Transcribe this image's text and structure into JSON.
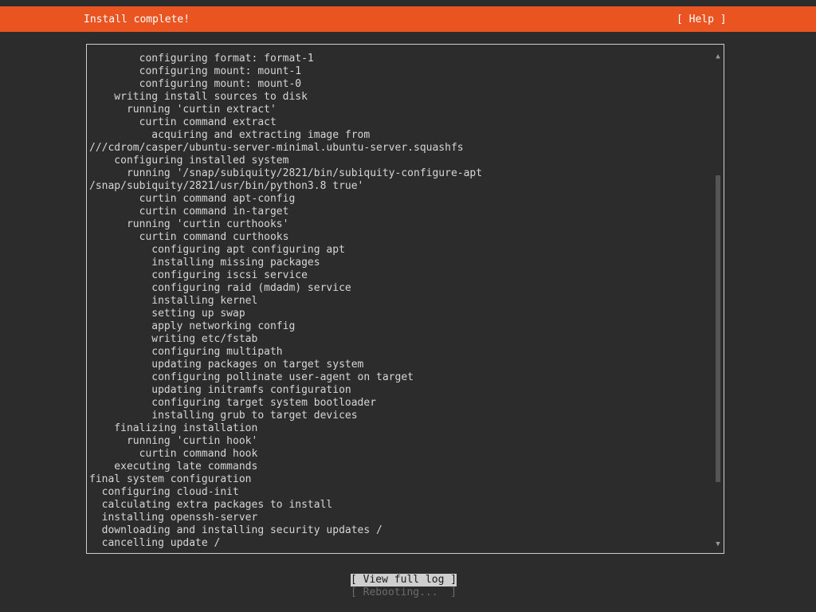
{
  "header": {
    "title": "Install complete!",
    "help_label": "[ Help ]"
  },
  "log": {
    "lines": [
      "        configuring format: format-1",
      "        configuring mount: mount-1",
      "        configuring mount: mount-0",
      "    writing install sources to disk",
      "      running 'curtin extract'",
      "        curtin command extract",
      "          acquiring and extracting image from",
      "///cdrom/casper/ubuntu-server-minimal.ubuntu-server.squashfs",
      "    configuring installed system",
      "      running '/snap/subiquity/2821/bin/subiquity-configure-apt",
      "/snap/subiquity/2821/usr/bin/python3.8 true'",
      "        curtin command apt-config",
      "        curtin command in-target",
      "      running 'curtin curthooks'",
      "        curtin command curthooks",
      "          configuring apt configuring apt",
      "          installing missing packages",
      "          configuring iscsi service",
      "          configuring raid (mdadm) service",
      "          installing kernel",
      "          setting up swap",
      "          apply networking config",
      "          writing etc/fstab",
      "          configuring multipath",
      "          updating packages on target system",
      "          configuring pollinate user-agent on target",
      "          updating initramfs configuration",
      "          configuring target system bootloader",
      "          installing grub to target devices",
      "    finalizing installation",
      "      running 'curtin hook'",
      "        curtin command hook",
      "    executing late commands",
      "final system configuration",
      "  configuring cloud-init",
      "  calculating extra packages to install",
      "  installing openssh-server",
      "  downloading and installing security updates /",
      "  cancelling update /"
    ],
    "scroll_up_glyph": "▲",
    "scroll_down_glyph": "▼",
    "scroll_position": 0.65
  },
  "buttons": {
    "view_log": "[ View full log ]",
    "rebooting": "[ Rebooting...  ]"
  },
  "colors": {
    "accent": "#e95420",
    "background": "#2c2c2c",
    "text": "#d6d6d6"
  }
}
